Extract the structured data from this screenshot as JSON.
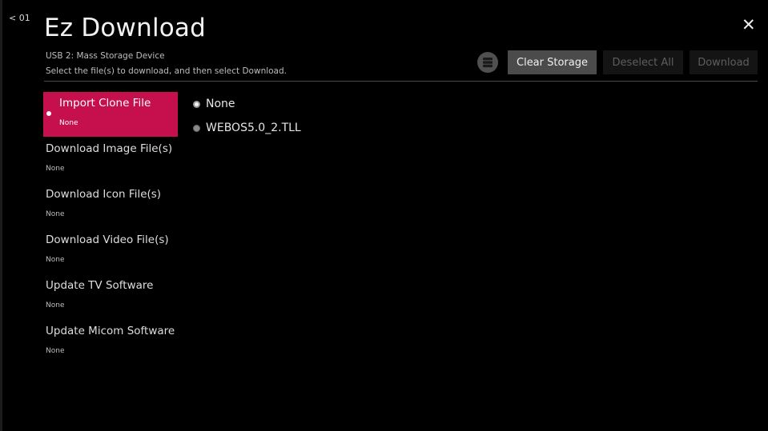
{
  "header": {
    "back_label": "< 01",
    "title": "Ez Download",
    "device": "USB 2: Mass Storage Device",
    "instruction": "Select the file(s) to download, and then select Download.",
    "close_glyph": "✕"
  },
  "toolbar": {
    "storage_icon": "storage-icon",
    "clear_storage_label": "Clear Storage",
    "deselect_all_label": "Deselect All",
    "download_label": "Download"
  },
  "menu": {
    "items": [
      {
        "label": "Import Clone File",
        "value": "None",
        "selected": true
      },
      {
        "label": "Download Image File(s)",
        "value": "None"
      },
      {
        "label": "Download Icon File(s)",
        "value": "None"
      },
      {
        "label": "Download Video File(s)",
        "value": "None"
      },
      {
        "label": "Update TV Software",
        "value": "None"
      },
      {
        "label": "Update Micom Software",
        "value": "None"
      }
    ]
  },
  "options": [
    {
      "label": "None",
      "checked": true
    },
    {
      "label": "WEBOS5.0_2.TLL",
      "checked": false
    }
  ],
  "colors": {
    "accent": "#c5104d",
    "background": "#000000"
  }
}
